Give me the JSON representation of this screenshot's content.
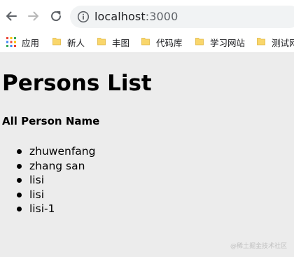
{
  "browser": {
    "url_host": "localhost",
    "url_port": ":3000",
    "apps_label": "应用",
    "bookmarks": [
      {
        "label": "新人"
      },
      {
        "label": "丰图"
      },
      {
        "label": "代码库"
      },
      {
        "label": "学习网站"
      },
      {
        "label": "测试网"
      }
    ],
    "icons": {
      "back": "arrow-left-icon",
      "forward": "arrow-right-icon",
      "reload": "reload-icon",
      "info": "info-icon",
      "apps": "apps-grid-icon",
      "folder": "folder-icon"
    },
    "colors": {
      "folder": "#f9d66b",
      "apps_grid": [
        "#ea4335",
        "#fbbc05",
        "#34a853",
        "#4285f4"
      ]
    }
  },
  "page": {
    "title": "Persons List",
    "section_heading": "All Person Name",
    "persons": [
      {
        "name": "zhuwenfang"
      },
      {
        "name": "zhang san"
      },
      {
        "name": "lisi"
      },
      {
        "name": "lisi"
      },
      {
        "name": "lisi-1"
      }
    ]
  },
  "watermark": "@稀土掘金技术社区"
}
